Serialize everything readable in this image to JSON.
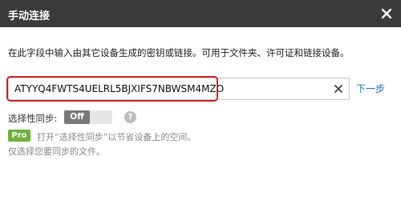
{
  "window": {
    "title": "手动连接",
    "close_icon": "close-icon"
  },
  "main": {
    "instruction": "在此字段中输入由其它设备生成的密钥或链接。可用于文件夹、许可证和链接设备。",
    "key_input_value": "ATYYQ4FWTS4UELRL5BJXIFS7NBWSM4MZO",
    "clear_icon": "close-icon",
    "next_label": "下一步"
  },
  "selective_sync": {
    "label": "选择性同步:",
    "toggle_text": "Off",
    "help_icon": "question-icon",
    "help_glyph": "?"
  },
  "pro_note": {
    "badge": "Pro",
    "line1": "打开“选择性同步”以节省设备上的空间。",
    "line2": "仅选择您要同步的文件。"
  },
  "colors": {
    "titlebar": "#3a3a3a",
    "highlight": "#d4252b",
    "link": "#1f6fb6",
    "pro_badge": "#6fb23b",
    "toggle_knob": "#7a7a7a"
  }
}
